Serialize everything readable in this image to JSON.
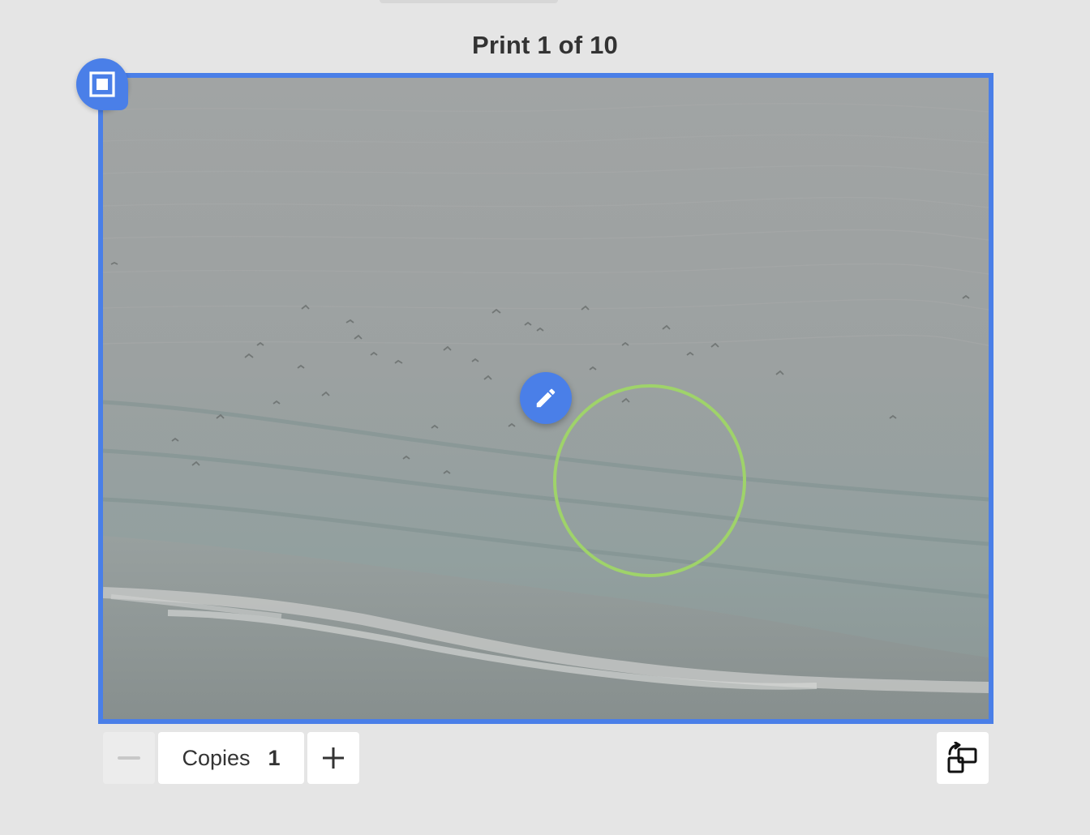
{
  "header": {
    "title": "Print 1 of 10"
  },
  "print": {
    "selected": true,
    "select_icon": "select-square-icon",
    "edit_icon": "pencil-icon"
  },
  "copies": {
    "label": "Copies",
    "value": "1",
    "decrement_icon": "minus-icon",
    "increment_icon": "plus-icon"
  },
  "orientation": {
    "icon": "rotate-orientation-icon"
  },
  "colors": {
    "accent": "#4a7fe8",
    "focus_ring": "#9fd36a",
    "background": "#e5e5e5"
  }
}
